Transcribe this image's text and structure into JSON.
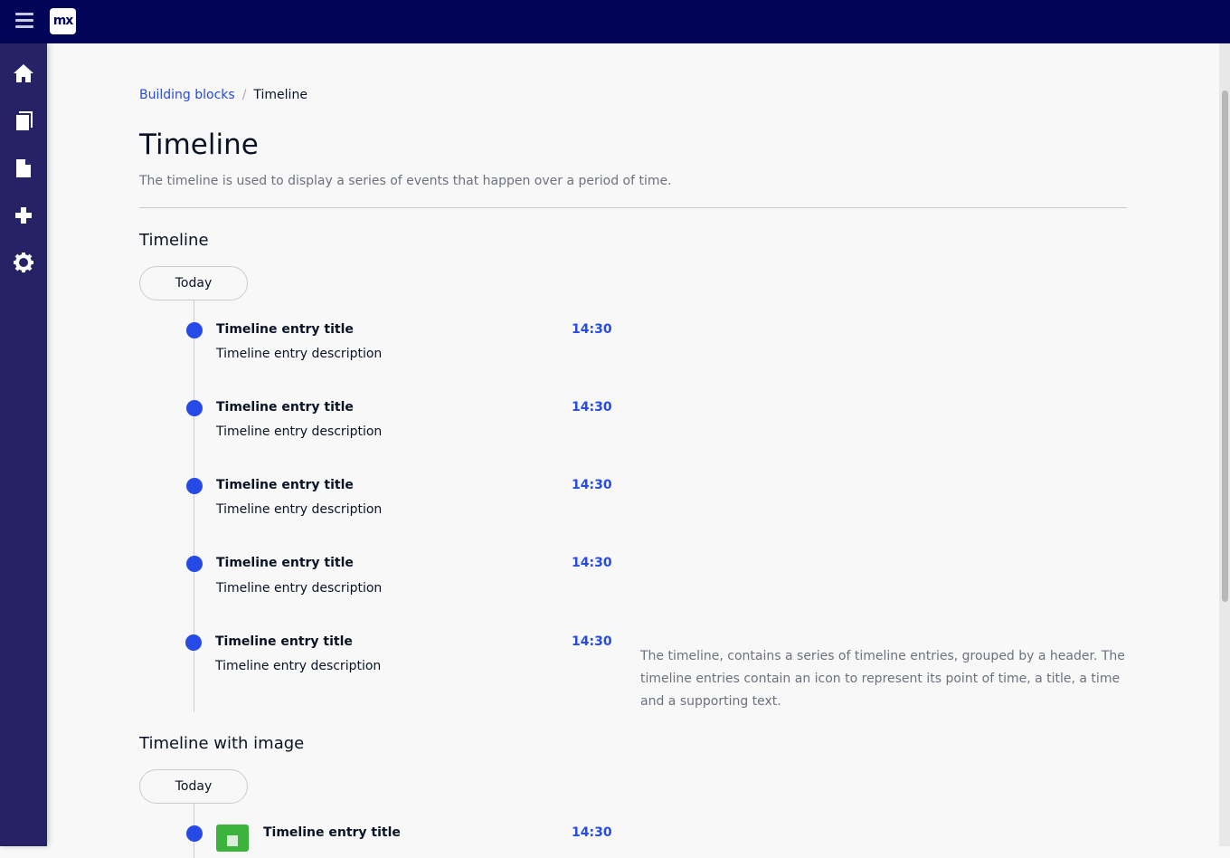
{
  "topbar": {
    "logo": "mx"
  },
  "sidebar": {
    "items": [
      "home",
      "library",
      "page",
      "add",
      "settings"
    ]
  },
  "breadcrumb": {
    "parent": "Building blocks",
    "separator": "/",
    "current": "Timeline"
  },
  "page": {
    "title": "Timeline",
    "subtitle": "The timeline is used to display a series of events that happen over a period of time."
  },
  "section1": {
    "title": "Timeline",
    "header": "Today",
    "entries": [
      {
        "title": "Timeline entry title",
        "description": "Timeline entry description",
        "time": "14:30"
      },
      {
        "title": "Timeline entry title",
        "description": "Timeline entry description",
        "time": "14:30"
      },
      {
        "title": "Timeline entry title",
        "description": "Timeline entry description",
        "time": "14:30"
      },
      {
        "title": "Timeline entry title",
        "description": "Timeline entry description",
        "time": "14:30"
      },
      {
        "title": "Timeline entry title",
        "description": "Timeline entry description",
        "time": "14:30"
      }
    ],
    "note": "The timeline, contains a series of timeline entries, grouped by a header. The timeline entries contain an icon to represent its point of time, a title, a time and a supporting text."
  },
  "section2": {
    "title": "Timeline with image",
    "header": "Today",
    "entries": [
      {
        "title": "Timeline entry title",
        "time": "14:30"
      }
    ]
  }
}
